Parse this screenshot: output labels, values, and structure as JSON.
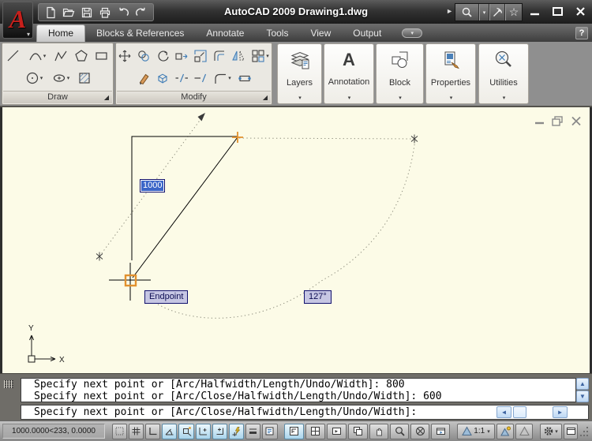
{
  "window": {
    "title": "AutoCAD 2009 Drawing1.dwg"
  },
  "icons": {
    "logo_glyph": "A",
    "caret_down": "▾",
    "expand_right": "►",
    "star": "☆",
    "help": "?",
    "arrow_up": "▲",
    "arrow_down": "▼",
    "arrow_left": "◀",
    "arrow_right": "▶",
    "launcher": "◢",
    "annotation_glyph": "A"
  },
  "tabs": [
    {
      "label": "Home",
      "active": true
    },
    {
      "label": "Blocks & References",
      "active": false
    },
    {
      "label": "Annotate",
      "active": false
    },
    {
      "label": "Tools",
      "active": false
    },
    {
      "label": "View",
      "active": false
    },
    {
      "label": "Output",
      "active": false
    }
  ],
  "ribbon": {
    "draw": {
      "title": "Draw",
      "buttons": [
        "line",
        "arc",
        "polyline",
        "polygon",
        "rectangle",
        "circle",
        "ellipse",
        "hatch"
      ]
    },
    "modify": {
      "title": "Modify",
      "buttons": [
        "move",
        "copy",
        "rotate",
        "stretch",
        "scale",
        "offset",
        "mirror",
        "array",
        "erase",
        "explode",
        "trim",
        "extend",
        "fillet",
        "join"
      ]
    },
    "panels": [
      {
        "label": "Layers"
      },
      {
        "label": "Annotation"
      },
      {
        "label": "Block"
      },
      {
        "label": "Properties"
      },
      {
        "label": "Utilities"
      }
    ]
  },
  "canvas": {
    "dynamic_input_value": "1000",
    "osnap_tooltip": "Endpoint",
    "angle_tooltip": "127°",
    "ucs": {
      "x": "X",
      "y": "Y"
    }
  },
  "command": {
    "history": [
      "Specify next point or [Arc/Halfwidth/Length/Undo/Width]: 800",
      "Specify next point or [Arc/Close/Halfwidth/Length/Undo/Width]: 600"
    ],
    "prompt": "Specify next point or [Arc/Close/Halfwidth/Length/Undo/Width]:"
  },
  "statusbar": {
    "coordinates": "1000.0000<233, 0.0000",
    "annotation_scale": "1:1",
    "toggles": [
      {
        "id": "snap",
        "on": false
      },
      {
        "id": "grid",
        "on": false
      },
      {
        "id": "ortho",
        "on": false
      },
      {
        "id": "polar",
        "on": true
      },
      {
        "id": "osnap",
        "on": true
      },
      {
        "id": "otrack",
        "on": true
      },
      {
        "id": "ducs",
        "on": true
      },
      {
        "id": "dyn",
        "on": true
      },
      {
        "id": "lwt",
        "on": false
      },
      {
        "id": "qp",
        "on": false
      }
    ]
  },
  "colors": {
    "canvas_bg": "#fcfbe7",
    "accent_orange": "#e2912e",
    "tooltip_bg": "#c6c6e3",
    "selection_blue": "#3b66c8",
    "toggle_on": "#a9d4ec"
  }
}
